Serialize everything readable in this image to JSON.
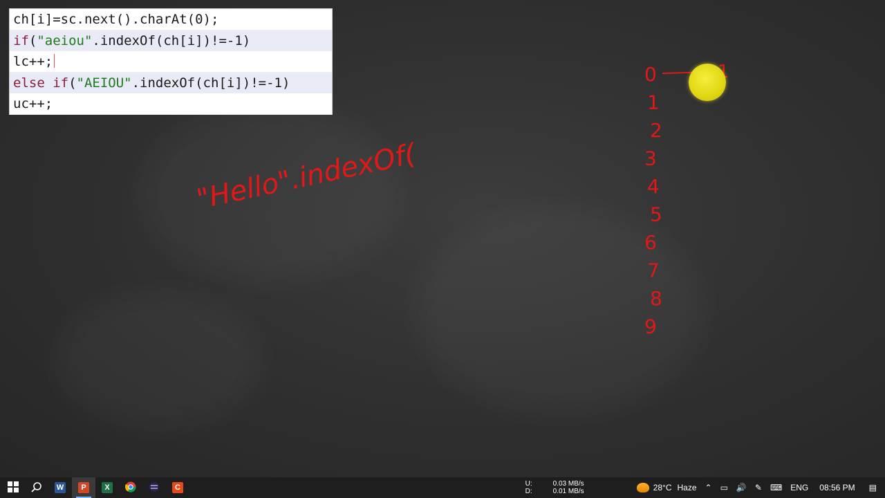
{
  "code_lines": [
    {
      "parts": [
        {
          "t": "ch[i]=sc.next().charAt(0);",
          "c": "plain"
        }
      ],
      "highlight": false
    },
    {
      "parts": [
        {
          "t": "if",
          "c": "kw"
        },
        {
          "t": "(",
          "c": "plain"
        },
        {
          "t": "\"aeiou\"",
          "c": "str"
        },
        {
          "t": ".indexOf(ch[i])!=-1)",
          "c": "plain"
        }
      ],
      "highlight": true
    },
    {
      "parts": [
        {
          "t": "lc++;",
          "c": "plain"
        }
      ],
      "highlight": false,
      "caret": true
    },
    {
      "parts": [
        {
          "t": "else if",
          "c": "kw"
        },
        {
          "t": "(",
          "c": "plain"
        },
        {
          "t": "\"AEIOU\"",
          "c": "str"
        },
        {
          "t": ".indexOf(ch[i])!=-1)",
          "c": "plain"
        }
      ],
      "highlight": true
    },
    {
      "parts": [
        {
          "t": "uc++;",
          "c": "plain"
        }
      ],
      "highlight": false
    }
  ],
  "annotations": {
    "handwriting": "\"Hello\".indexOf(",
    "index_digits": [
      "0",
      "1",
      "2",
      "3",
      "4",
      "5",
      "6",
      "7",
      "8",
      "9"
    ],
    "arrow_label": "1",
    "ink_color": "#e01818"
  },
  "taskbar": {
    "apps": [
      {
        "name": "windows-start",
        "icon": "windows-logo-icon"
      },
      {
        "name": "search",
        "icon": "search-icon"
      },
      {
        "name": "word",
        "icon": "word-icon",
        "letter": "W",
        "color": "#2b5797"
      },
      {
        "name": "powerpoint",
        "icon": "powerpoint-icon",
        "letter": "P",
        "color": "#d24726",
        "active": true
      },
      {
        "name": "excel",
        "icon": "excel-icon",
        "letter": "X",
        "color": "#1e7145"
      },
      {
        "name": "chrome",
        "icon": "chrome-icon"
      },
      {
        "name": "eclipse",
        "icon": "eclipse-icon"
      },
      {
        "name": "recorder",
        "icon": "screen-recorder-icon",
        "letter": "C",
        "color": "#e64a19"
      }
    ],
    "network": {
      "upload_label": "U:",
      "download_label": "D:",
      "upload": "0.03 MB/s",
      "download": "0.01 MB/s"
    },
    "weather": {
      "temp": "28°C",
      "condition": "Haze"
    },
    "language": "ENG",
    "time": "08:56 PM"
  }
}
